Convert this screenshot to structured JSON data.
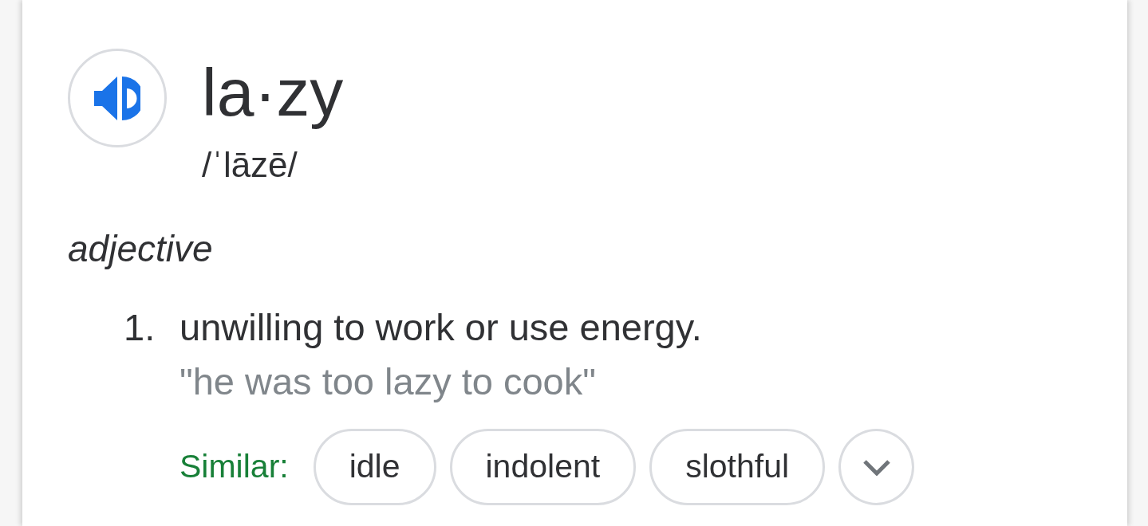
{
  "entry": {
    "headword": "la·zy",
    "pronunciation": "/ˈlāzē/"
  },
  "part_of_speech": "adjective",
  "senses": [
    {
      "number": "1.",
      "definition": "unwilling to work or use energy.",
      "example": "\"he was too lazy to cook\"",
      "similar_label": "Similar:",
      "similar": [
        "idle",
        "indolent",
        "slothful"
      ],
      "more_expanded": false
    }
  ]
}
